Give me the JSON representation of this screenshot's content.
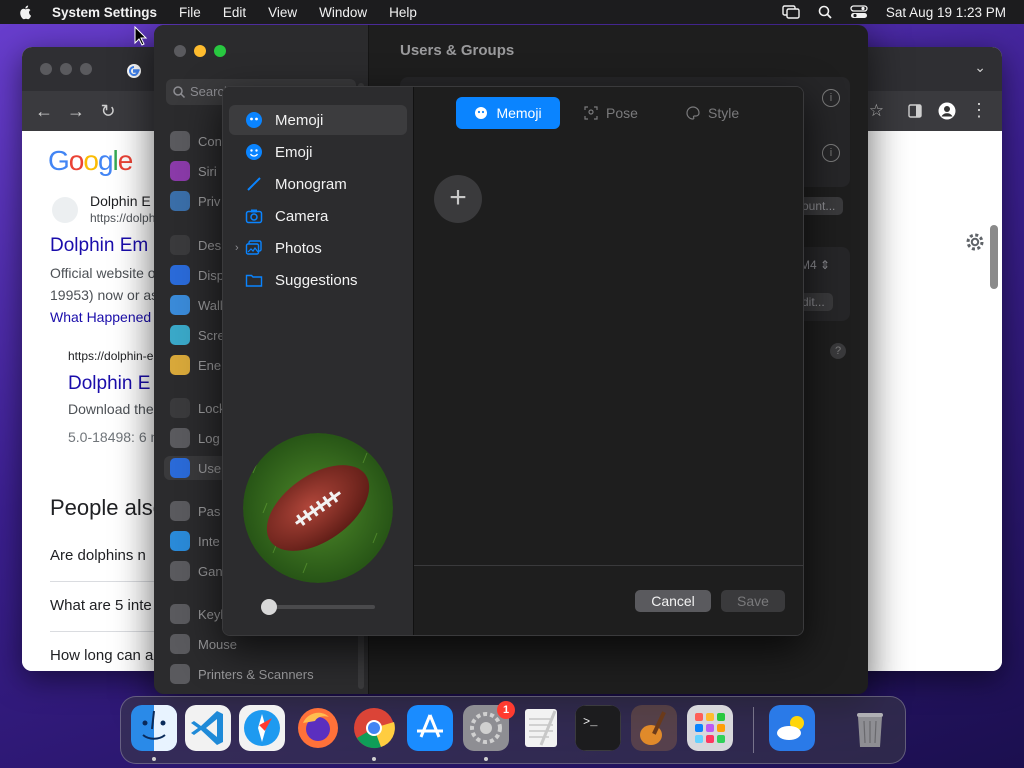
{
  "menubar": {
    "app_name": "System Settings",
    "menus": [
      "File",
      "Edit",
      "View",
      "Window",
      "Help"
    ],
    "clock": "Sat Aug 19  1:23 PM"
  },
  "browser": {
    "search_result": {
      "site_name": "Dolphin E",
      "url": "https://dolph",
      "title": "Dolphin Em",
      "snippet_line1": "Official website o",
      "snippet_line2": "19953) now or as",
      "link": "What Happened"
    },
    "search_result2": {
      "url": "https://dolphin-e",
      "title": "Dolphin E",
      "snippet": "Download the",
      "meta": "5.0-18498: 6 n"
    },
    "people_also_ask": "People also",
    "questions": [
      "Are dolphins n",
      "What are 5 inte",
      "How long can a"
    ]
  },
  "settings": {
    "window_title": "Users & Groups",
    "search_placeholder": "Search",
    "sidebar": [
      {
        "label": "Con",
        "color": "#5a5a5e"
      },
      {
        "label": "Siri",
        "color": "#8a3aa8"
      },
      {
        "label": "Priv",
        "color": "#3a6ea8"
      },
      {
        "label": "Des",
        "color": "#3a3a3c"
      },
      {
        "label": "Disp",
        "color": "#2a6ad8"
      },
      {
        "label": "Wall",
        "color": "#3a8ad8"
      },
      {
        "label": "Scre",
        "color": "#3aa8c8"
      },
      {
        "label": "Ene",
        "color": "#d8a83a"
      },
      {
        "label": "Lock",
        "color": "#3a3a3c"
      },
      {
        "label": "Log",
        "color": "#5a5a5e"
      },
      {
        "label": "Use",
        "color": "#2a6ad8"
      },
      {
        "label": "Pas",
        "color": "#5a5a5e"
      },
      {
        "label": "Inte",
        "color": "#2a8ad8"
      },
      {
        "label": "Gan",
        "color": "#5a5a5e"
      },
      {
        "label": "Keyl",
        "color": "#5a5a5e"
      },
      {
        "label": "Mouse",
        "color": "#5a5a5e"
      },
      {
        "label": "Printers & Scanners",
        "color": "#5a5a5e"
      }
    ],
    "account_button": "ount...",
    "stepper_value": "M4",
    "edit_button": "dit..."
  },
  "picker": {
    "categories": [
      {
        "label": "Memoji",
        "selected": true
      },
      {
        "label": "Emoji",
        "selected": false
      },
      {
        "label": "Monogram",
        "selected": false
      },
      {
        "label": "Camera",
        "selected": false
      },
      {
        "label": "Photos",
        "selected": false
      },
      {
        "label": "Suggestions",
        "selected": false
      }
    ],
    "segments": [
      {
        "label": "Memoji",
        "active": true
      },
      {
        "label": "Pose",
        "active": false
      },
      {
        "label": "Style",
        "active": false
      }
    ],
    "zoom_level": 0,
    "cancel_label": "Cancel",
    "save_label": "Save"
  },
  "dock": {
    "apps": [
      "Finder",
      "Visual Studio Code",
      "Safari",
      "Firefox",
      "Google Chrome",
      "App Store",
      "System Settings",
      "TextEdit",
      "Terminal",
      "GarageBand",
      "Launchpad",
      "Weather",
      "Trash"
    ],
    "settings_badge": "1"
  },
  "colors": {
    "accent": "#0a84ff"
  }
}
